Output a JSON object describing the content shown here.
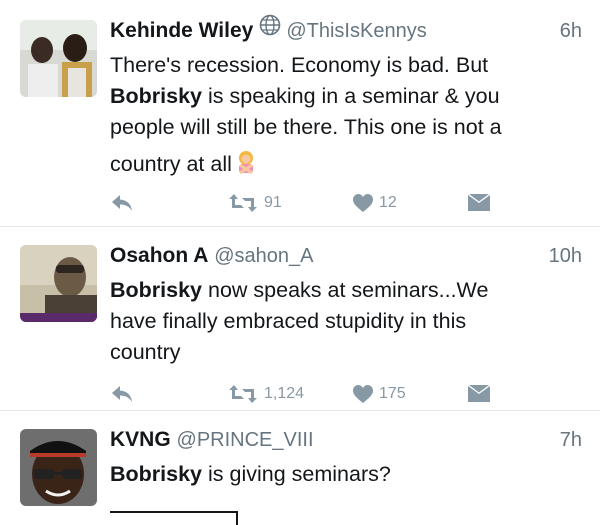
{
  "tweets": [
    {
      "name": "Kehinde Wiley",
      "handle": "@ThisIsKennys",
      "time": "6h",
      "text_lines": [
        [
          {
            "t": "There's recession. Economy is bad. But",
            "b": false
          }
        ],
        [
          {
            "t": "Bobrisky",
            "b": true
          },
          {
            "t": " is speaking in a seminar & you",
            "b": false
          }
        ],
        [
          {
            "t": "people will still be there. This one is not a",
            "b": false
          }
        ],
        [
          {
            "t": "country at all",
            "b": false
          }
        ]
      ],
      "retweets": "91",
      "likes": "12",
      "has_globe": true,
      "has_emoji": true
    },
    {
      "name": "Osahon A",
      "handle": "@sahon_A",
      "time": "10h",
      "text_lines": [
        [
          {
            "t": "Bobrisky",
            "b": true
          },
          {
            "t": " now speaks at seminars...We",
            "b": false
          }
        ],
        [
          {
            "t": "have finally embraced stupidity in this",
            "b": false
          }
        ],
        [
          {
            "t": "country",
            "b": false
          }
        ]
      ],
      "retweets": "1,124",
      "likes": "175",
      "has_globe": false,
      "has_emoji": false
    },
    {
      "name": "KVNG",
      "handle": "@PRINCE_VIII",
      "time": "7h",
      "text_lines": [
        [
          {
            "t": "Bobrisky",
            "b": true
          },
          {
            "t": " is giving seminars?",
            "b": false
          }
        ]
      ],
      "has_globe": false,
      "has_emoji": false
    }
  ],
  "colors": {
    "icon_gray": "#8899a6",
    "secondary_text": "#66757f",
    "separator": "#e1e8ed"
  },
  "icons": [
    "reply-icon",
    "retweet-icon",
    "like-icon",
    "direct-message-icon",
    "globe-icon",
    "no-gesture-emoji"
  ]
}
